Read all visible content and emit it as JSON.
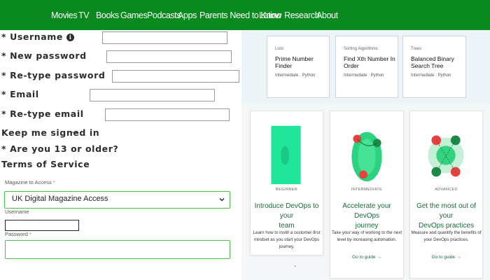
{
  "nav": {
    "items": [
      "Movies",
      "TV",
      "Books",
      "Games",
      "Podcasts",
      "Apps",
      "Parents Need to Know",
      "Latino",
      "Research",
      "About"
    ]
  },
  "form": {
    "username_label": "* Username",
    "new_password_label": "* New password",
    "retype_password_label": "* Re-type password",
    "email_label": "* Email",
    "retype_email_label": "* Re-type email",
    "keep_signed_label": "Keep me signed in",
    "age_label": "* Are you 13 or older?",
    "terms_label": "Terms of Service",
    "magazine_label": "Magazine to Access",
    "magazine_value": "UK Digital Magazine Access",
    "username2_label": "Username",
    "password_label": "Password",
    "required_mark": "*"
  },
  "labs": [
    {
      "tag": "Lists",
      "title": "Prime Number Finder",
      "meta": "Intermediate · Python"
    },
    {
      "tag": "Sorting Algorithms",
      "title": "Find Xth Number In Order",
      "meta": "Intermediate · Python"
    },
    {
      "tag": "Trees",
      "title": "Balanced Binary Search Tree",
      "meta": "Intermediate · Python"
    }
  ],
  "devops": [
    {
      "level": "BEGINNER",
      "title_line1": "Introduce DevOps to your",
      "title_line2": "team",
      "desc_line1": "Learn how to instill a customer-first",
      "desc_line2": "mindset as you start your DevOps",
      "desc_line3": "journey.",
      "link": ""
    },
    {
      "level": "INTERMEDIATE",
      "title_line1": "Accelerate your DevOps",
      "title_line2": "journey",
      "desc_line1": "Take your way of working to the next",
      "desc_line2": "level by increasing automation.",
      "desc_line3": "",
      "link": "Go to guide →"
    },
    {
      "level": "ADVANCED",
      "title_line1": "Get the most out of your",
      "title_line2": "DevOps practices",
      "desc_line1": "Measure and quantify the benefits of",
      "desc_line2": "your DevOps practices.",
      "desc_line3": "",
      "link": "Go to guide →"
    }
  ],
  "colors": {
    "nav_bg": "#0a8a1e",
    "accent_green": "#1a6b38",
    "select_border": "#48c04c",
    "required": "#d97d2a"
  },
  "icons": [
    "info-icon",
    "cursor-icon",
    "chevron-down-icon",
    "arrow-right-icon"
  ]
}
